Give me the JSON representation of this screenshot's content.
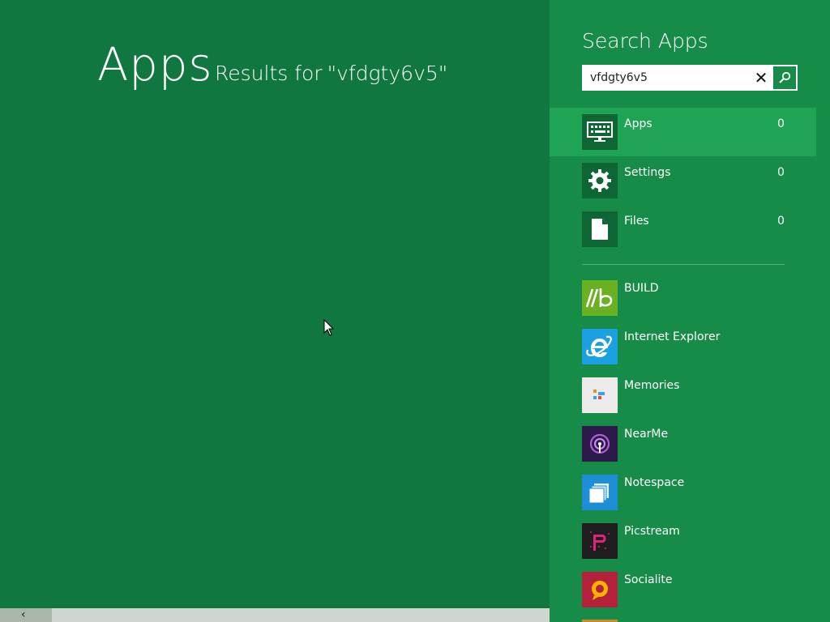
{
  "results": {
    "title": "Apps",
    "results_prefix": "Results for",
    "query_display": "\"vfdgty6v5\""
  },
  "pane": {
    "title": "Search Apps",
    "search": {
      "value": "vfdgty6v5",
      "placeholder": ""
    },
    "scopes": [
      {
        "label": "Apps",
        "count": "0",
        "icon": "keyboard-monitor-icon",
        "selected": true
      },
      {
        "label": "Settings",
        "count": "0",
        "icon": "gear-icon",
        "selected": false
      },
      {
        "label": "Files",
        "count": "0",
        "icon": "file-icon",
        "selected": false
      }
    ],
    "apps": [
      {
        "label": "BUILD",
        "icon": "build-icon",
        "color": "#6ab023"
      },
      {
        "label": "Internet Explorer",
        "icon": "internet-explorer-icon",
        "color": "#1ba1e2"
      },
      {
        "label": "Memories",
        "icon": "memories-icon",
        "color": "#ebebeb"
      },
      {
        "label": "NearMe",
        "icon": "nearme-icon",
        "color": "#2b1a4a"
      },
      {
        "label": "Notespace",
        "icon": "notespace-icon",
        "color": "#1e8fd6"
      },
      {
        "label": "Picstream",
        "icon": "picstream-icon",
        "color": "#1e1e1e"
      },
      {
        "label": "Socialite",
        "icon": "socialite-icon",
        "color": "#b3213b"
      }
    ]
  },
  "colors": {
    "background": "#0f773f",
    "pane": "#168c48",
    "selected_scope": "#1fa456"
  }
}
